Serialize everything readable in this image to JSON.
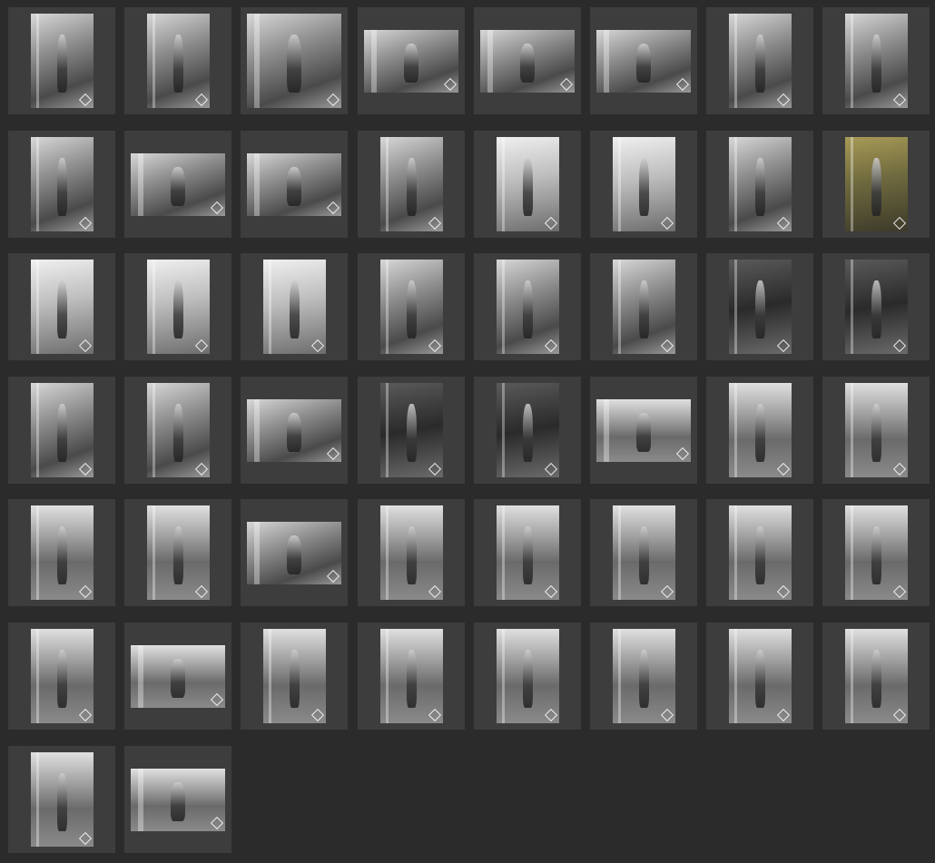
{
  "gallery": {
    "background": "#2b2b2b",
    "cell_color": "#3d3d3d",
    "badge_icon": "diamond-watermark-icon",
    "photos": [
      {
        "tone": "mono",
        "orient": "portrait"
      },
      {
        "tone": "mono",
        "orient": "portrait"
      },
      {
        "tone": "mono",
        "orient": "square"
      },
      {
        "tone": "mono",
        "orient": "landscape"
      },
      {
        "tone": "mono",
        "orient": "landscape"
      },
      {
        "tone": "mono",
        "orient": "landscape"
      },
      {
        "tone": "mono",
        "orient": "portrait"
      },
      {
        "tone": "mono",
        "orient": "portrait"
      },
      {
        "tone": "mono",
        "orient": "portrait"
      },
      {
        "tone": "mono",
        "orient": "landscape"
      },
      {
        "tone": "mono",
        "orient": "landscape"
      },
      {
        "tone": "mono",
        "orient": "portrait"
      },
      {
        "tone": "light",
        "orient": "portrait"
      },
      {
        "tone": "light",
        "orient": "portrait"
      },
      {
        "tone": "mono",
        "orient": "portrait"
      },
      {
        "tone": "color",
        "orient": "portrait"
      },
      {
        "tone": "light",
        "orient": "portrait"
      },
      {
        "tone": "light",
        "orient": "portrait"
      },
      {
        "tone": "light",
        "orient": "portrait"
      },
      {
        "tone": "mono",
        "orient": "portrait"
      },
      {
        "tone": "mono",
        "orient": "portrait"
      },
      {
        "tone": "mono",
        "orient": "portrait"
      },
      {
        "tone": "dark",
        "orient": "portrait"
      },
      {
        "tone": "dark",
        "orient": "portrait"
      },
      {
        "tone": "mono",
        "orient": "portrait"
      },
      {
        "tone": "mono",
        "orient": "portrait"
      },
      {
        "tone": "mono",
        "orient": "landscape"
      },
      {
        "tone": "dark",
        "orient": "portrait"
      },
      {
        "tone": "dark",
        "orient": "portrait"
      },
      {
        "tone": "field",
        "orient": "landscape"
      },
      {
        "tone": "field",
        "orient": "portrait"
      },
      {
        "tone": "field",
        "orient": "portrait"
      },
      {
        "tone": "field",
        "orient": "portrait"
      },
      {
        "tone": "field",
        "orient": "portrait"
      },
      {
        "tone": "mono",
        "orient": "landscape"
      },
      {
        "tone": "field",
        "orient": "portrait"
      },
      {
        "tone": "field",
        "orient": "portrait"
      },
      {
        "tone": "field",
        "orient": "portrait"
      },
      {
        "tone": "field",
        "orient": "portrait"
      },
      {
        "tone": "field",
        "orient": "portrait"
      },
      {
        "tone": "field",
        "orient": "portrait"
      },
      {
        "tone": "field",
        "orient": "landscape"
      },
      {
        "tone": "field",
        "orient": "portrait"
      },
      {
        "tone": "field",
        "orient": "portrait"
      },
      {
        "tone": "field",
        "orient": "portrait"
      },
      {
        "tone": "field",
        "orient": "portrait"
      },
      {
        "tone": "field",
        "orient": "portrait"
      },
      {
        "tone": "field",
        "orient": "portrait"
      },
      {
        "tone": "field",
        "orient": "portrait"
      },
      {
        "tone": "field",
        "orient": "landscape"
      }
    ]
  }
}
